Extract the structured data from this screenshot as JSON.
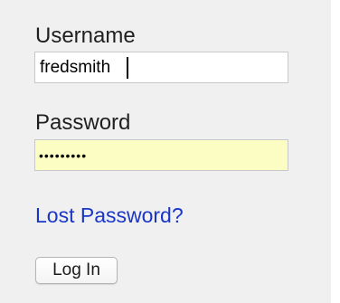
{
  "login_form": {
    "username_label": "Username",
    "username_value": "fredsmith",
    "password_label": "Password",
    "password_value": "•••••••••",
    "lost_password_link": "Lost Password?",
    "login_button": "Log In"
  },
  "colors": {
    "panel_background": "#f0f0f0",
    "password_autofill_background": "#fbfdc2",
    "link": "#1a36c6"
  }
}
